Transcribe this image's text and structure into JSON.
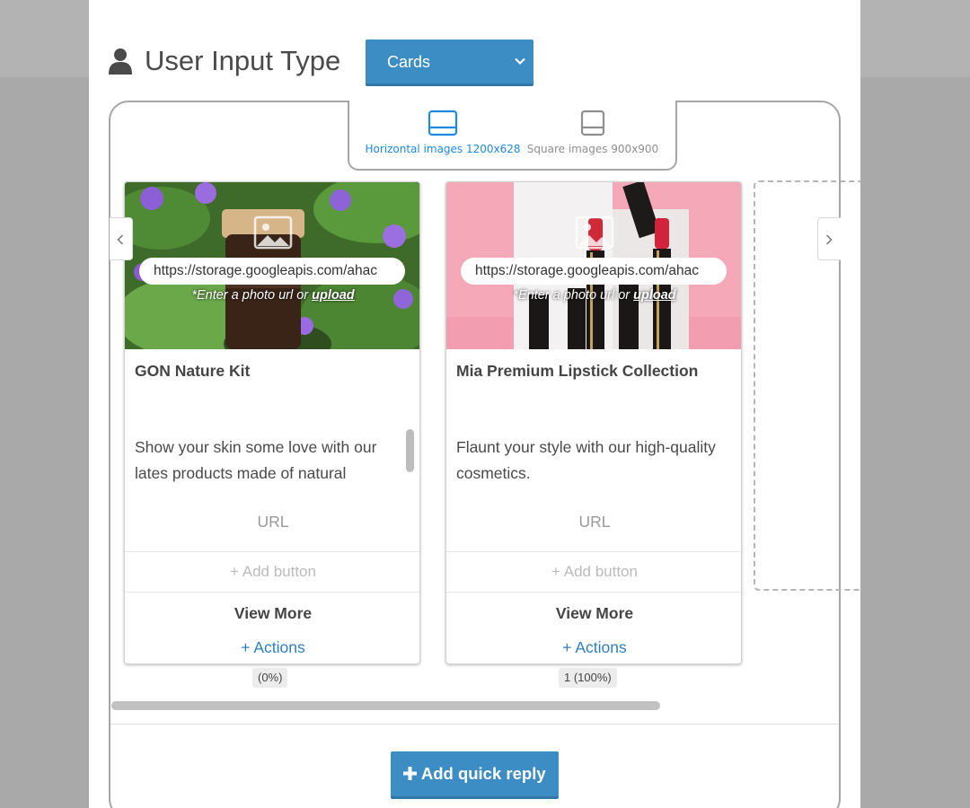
{
  "header": {
    "title": "User Input Type",
    "type_select": {
      "value": "Cards",
      "icon": "chevron-down-icon"
    },
    "user_icon": "user-icon"
  },
  "image_ratio": {
    "selected": "horizontal",
    "horizontal_label": "Horizontal images 1200x628",
    "square_label": "Square images 900x900",
    "accent_color": "#1e88e5"
  },
  "image_hint": {
    "prefix": "*Enter a photo url or ",
    "link": "upload"
  },
  "cards": [
    {
      "image_url": "https://storage.googleapis.com/ahac",
      "title": "GON Nature Kit",
      "description": "Show your skin some love with our lates products made of natural",
      "url_label": "URL",
      "add_button_label": "+ Add button",
      "button_label": "View More",
      "actions_label": "+ Actions",
      "stat": "(0%)"
    },
    {
      "image_url": "https://storage.googleapis.com/ahac",
      "title": "Mia Premium Lipstick Collection",
      "description": "Flaunt your style with our high-quality cosmetics.",
      "url_label": "URL",
      "add_button_label": "+ Add button",
      "button_label": "View More",
      "actions_label": "+ Actions",
      "stat": "1 (100%)"
    }
  ],
  "footer": {
    "quick_reply_label": "Add quick reply",
    "quick_reply_icon": "plus-icon",
    "button_color": "#3b8dc4"
  }
}
